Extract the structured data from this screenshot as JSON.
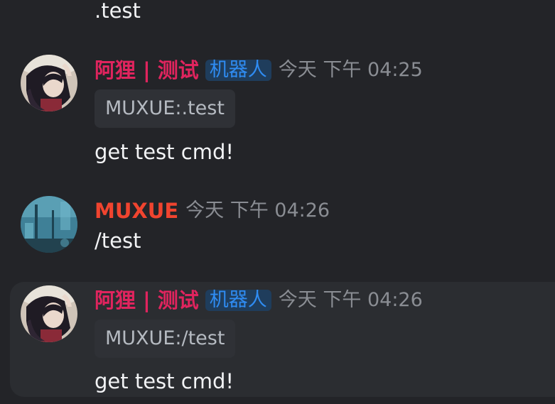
{
  "colors": {
    "background": "#232428",
    "hover_background": "#2b2d31",
    "bot_name": "#e0245e",
    "user_name": "#f0442f",
    "bot_badge_text": "#2f8cf2",
    "bot_badge_bg": "#1f3d5c",
    "timestamp": "#8a8d93",
    "message_text": "#f2f3f5",
    "embed_text": "#b5bac1"
  },
  "messages": [
    {
      "content": ".test"
    },
    {
      "author": "阿狸 | 测试",
      "badge": "机器人",
      "timestamp": "今天 下午 04:25",
      "embed": "MUXUE:.test",
      "content": "get test cmd!",
      "avatar_icon": "anime-character-avatar-icon"
    },
    {
      "author": "MUXUE",
      "timestamp": "今天 下午 04:26",
      "content": "/test",
      "avatar_icon": "blue-scene-avatar-icon"
    },
    {
      "author": "阿狸 | 测试",
      "badge": "机器人",
      "timestamp": "今天 下午 04:26",
      "embed": "MUXUE:/test",
      "content": "get test cmd!",
      "avatar_icon": "anime-character-avatar-icon"
    }
  ]
}
